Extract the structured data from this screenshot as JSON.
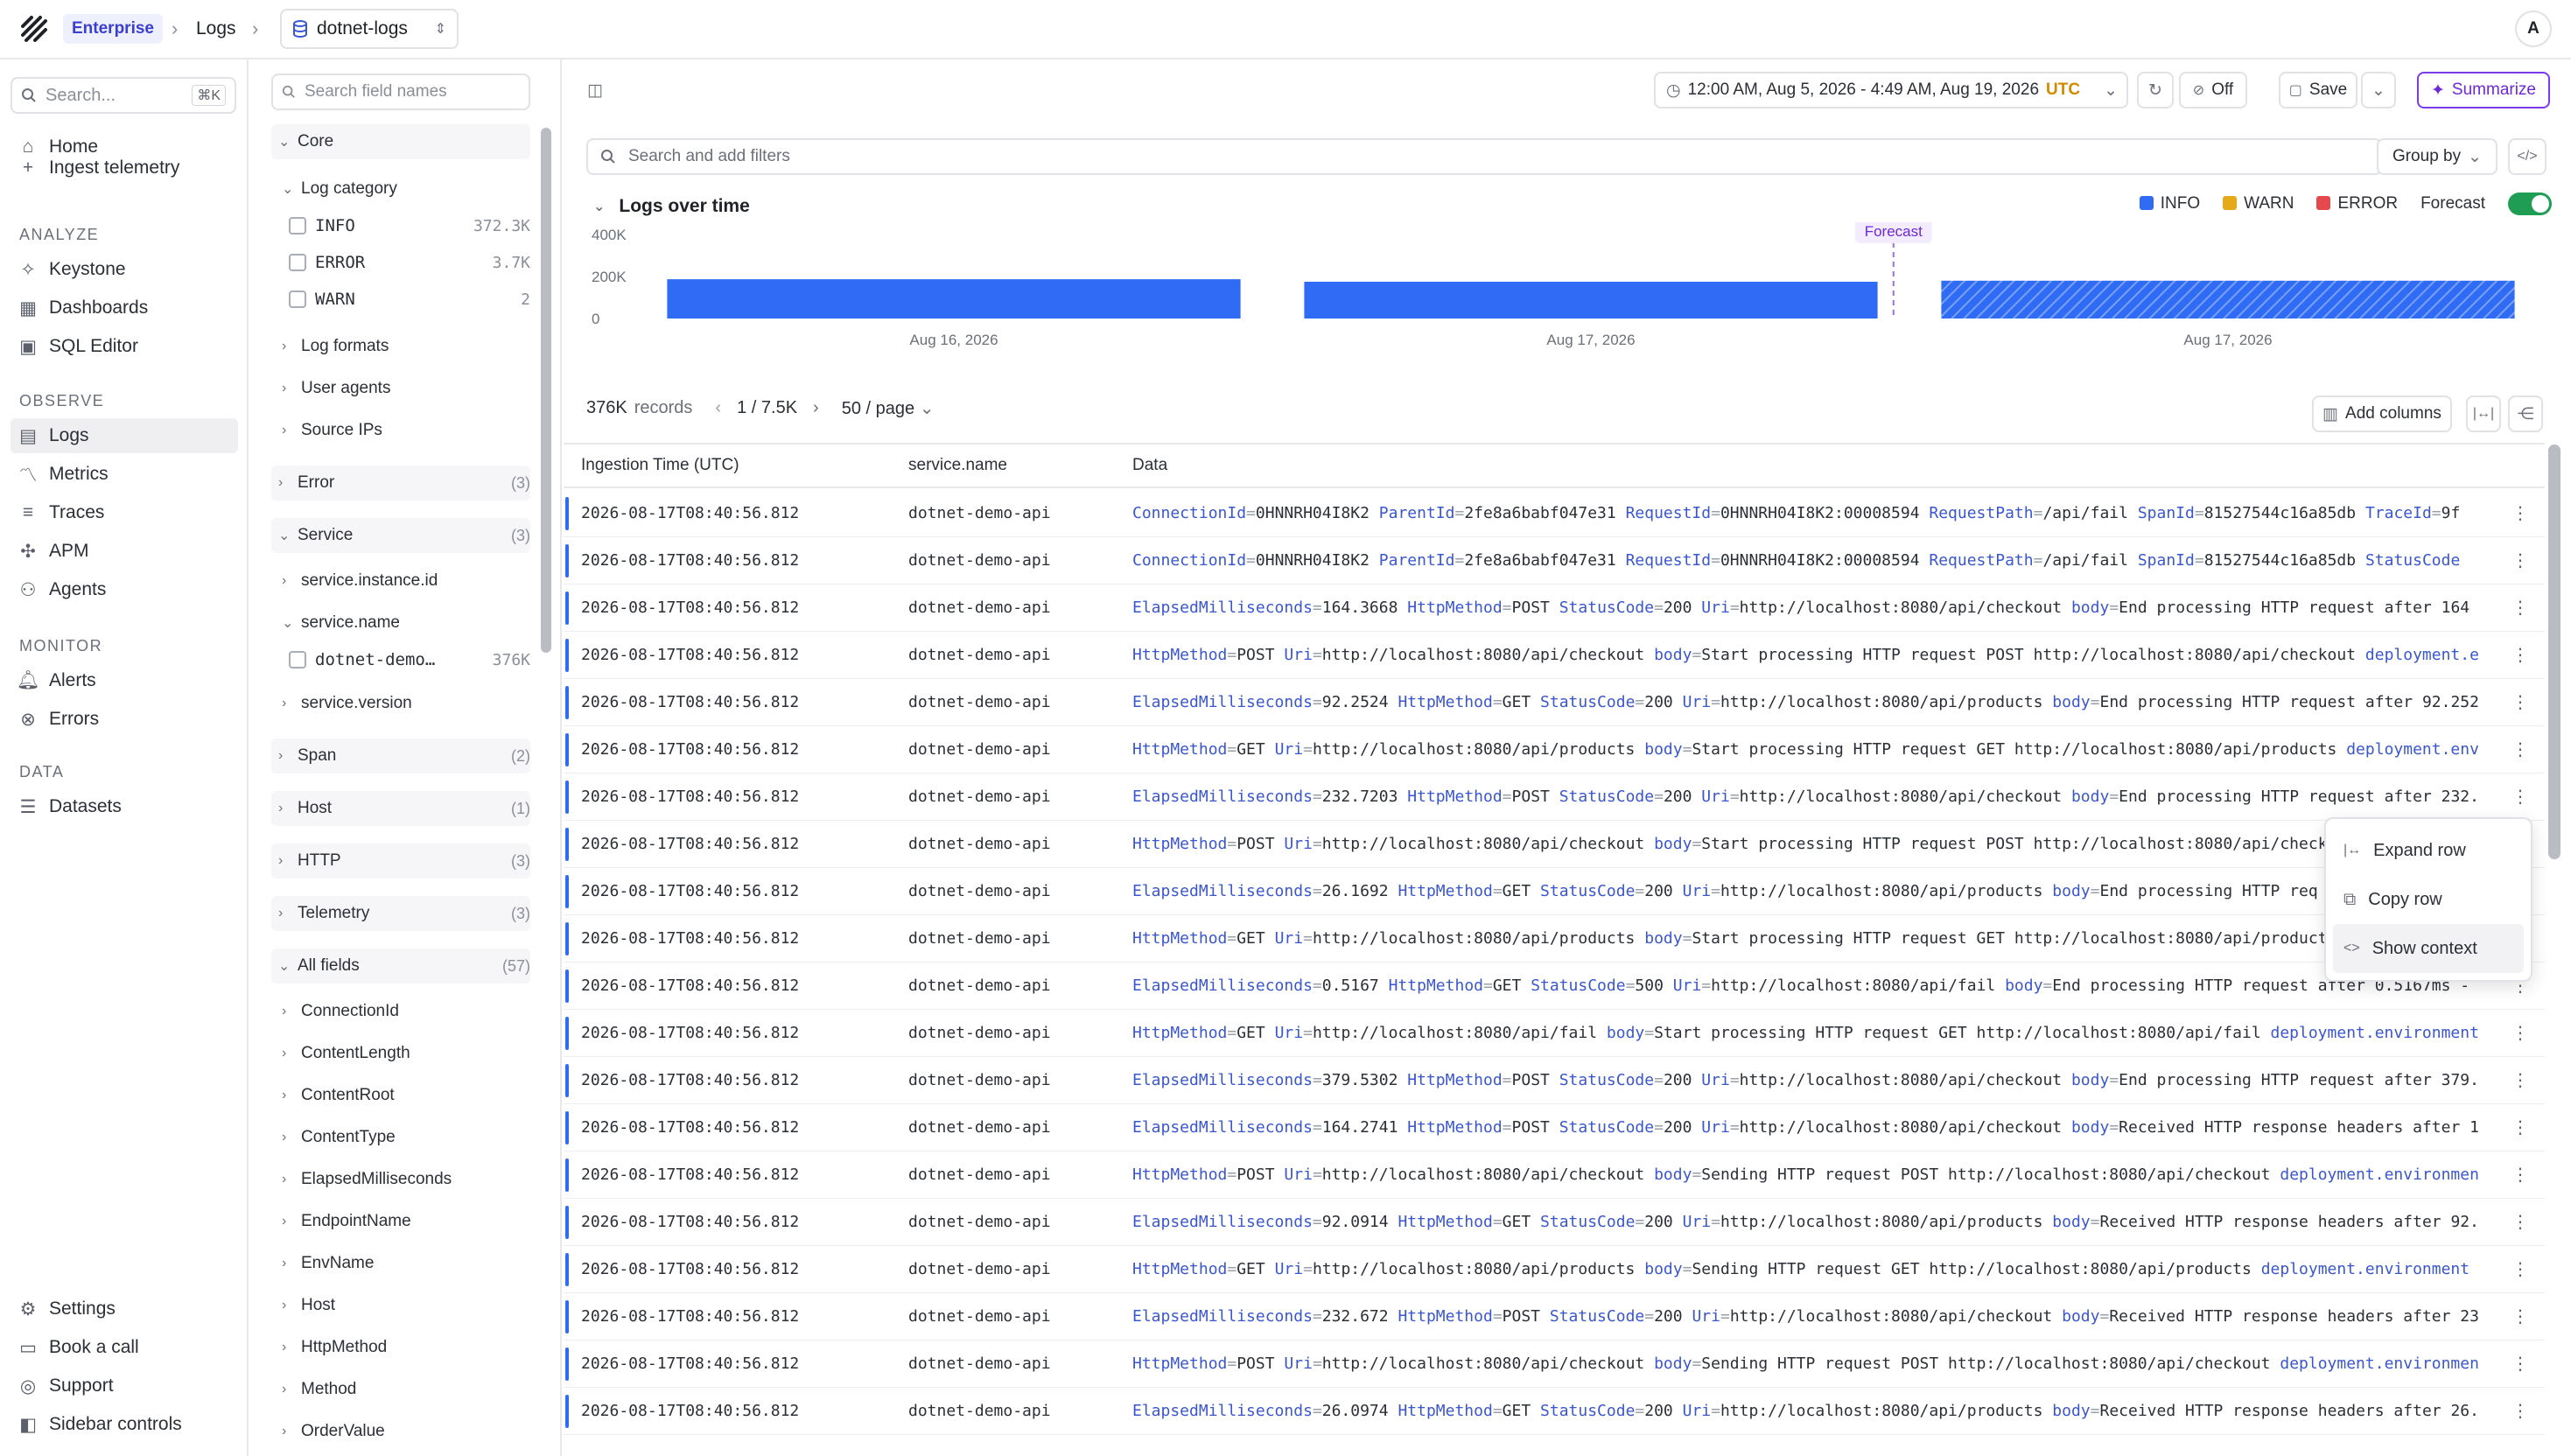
{
  "topbar": {
    "org": "Enterprise",
    "section": "Logs",
    "dataset": "dotnet-logs",
    "avatar_initial": "A"
  },
  "nav": {
    "search_placeholder": "Search...",
    "search_shortcut": "⌘K",
    "top_items": [
      {
        "label": "Home",
        "icon": "home-icon"
      },
      {
        "label": "Ingest telemetry",
        "icon": "plus-icon"
      }
    ],
    "sections": [
      {
        "title": "ANALYZE",
        "items": [
          {
            "label": "Keystone",
            "icon": "sparkle-icon"
          },
          {
            "label": "Dashboards",
            "icon": "dashboard-icon"
          },
          {
            "label": "SQL Editor",
            "icon": "terminal-icon"
          }
        ]
      },
      {
        "title": "OBSERVE",
        "items": [
          {
            "label": "Logs",
            "icon": "logs-icon",
            "active": true
          },
          {
            "label": "Metrics",
            "icon": "metrics-icon"
          },
          {
            "label": "Traces",
            "icon": "traces-icon"
          },
          {
            "label": "APM",
            "icon": "apm-icon"
          },
          {
            "label": "Agents",
            "icon": "agents-icon"
          }
        ]
      },
      {
        "title": "MONITOR",
        "items": [
          {
            "label": "Alerts",
            "icon": "bell-icon"
          },
          {
            "label": "Errors",
            "icon": "error-icon"
          }
        ]
      },
      {
        "title": "DATA",
        "items": [
          {
            "label": "Datasets",
            "icon": "database-icon"
          }
        ]
      }
    ],
    "bottom_items": [
      {
        "label": "Settings",
        "icon": "gear-icon"
      },
      {
        "label": "Book a call",
        "icon": "calendar-icon"
      },
      {
        "label": "Support",
        "icon": "support-icon"
      },
      {
        "label": "Sidebar controls",
        "icon": "sidebar-icon"
      }
    ]
  },
  "fields": {
    "search_placeholder": "Search field names",
    "core": "Core",
    "log_category": "Log category",
    "categories": [
      {
        "name": "INFO",
        "count": "372.3K"
      },
      {
        "name": "ERROR",
        "count": "3.7K"
      },
      {
        "name": "WARN",
        "count": "2"
      }
    ],
    "log_formats": "Log formats",
    "user_agents": "User agents",
    "source_ips": "Source IPs",
    "error": {
      "label": "Error",
      "count": "(3)"
    },
    "service": {
      "label": "Service",
      "count": "(3)"
    },
    "service_instance_id": "service.instance.id",
    "service_name": "service.name",
    "service_name_value": {
      "name": "dotnet-demo…",
      "count": "376K"
    },
    "service_version": "service.version",
    "span": {
      "label": "Span",
      "count": "(2)"
    },
    "host": {
      "label": "Host",
      "count": "(1)"
    },
    "http": {
      "label": "HTTP",
      "count": "(3)"
    },
    "telemetry": {
      "label": "Telemetry",
      "count": "(3)"
    },
    "all_fields": {
      "label": "All fields",
      "count": "(57)"
    },
    "all_field_items": [
      "ConnectionId",
      "ContentLength",
      "ContentRoot",
      "ContentType",
      "ElapsedMilliseconds",
      "EndpointName",
      "EnvName",
      "Host",
      "HttpMethod",
      "Method",
      "OrderValue"
    ]
  },
  "toolbar": {
    "time_range": "12:00 AM, Aug 5, 2026 - 4:49 AM, Aug 19, 2026",
    "timezone": "UTC",
    "refresh_state": "Off",
    "save_label": "Save",
    "summarize_label": "Summarize",
    "filter_placeholder": "Search and add filters",
    "group_by_label": "Group by"
  },
  "chart_data": {
    "type": "bar",
    "title": "Logs over time",
    "categories": [
      "Aug 16, 2026",
      "Aug 17, 2026",
      "Aug 17, 2026"
    ],
    "series": [
      {
        "name": "INFO",
        "values": [
          187000,
          175000,
          180000
        ],
        "color": "#2f6bf5"
      },
      {
        "name": "WARN",
        "values": [
          0,
          0,
          0
        ],
        "color": "#e6a91a"
      },
      {
        "name": "ERROR",
        "values": [
          1800,
          1700,
          1800
        ],
        "color": "#e5484d"
      }
    ],
    "forecast_label": "Forecast",
    "forecast_toggle_label": "Forecast",
    "forecast_start_index": 2,
    "y_ticks": [
      "400K",
      "200K",
      "0"
    ],
    "ylim": [
      0,
      400000
    ]
  },
  "records": {
    "count": "376K",
    "label": "records",
    "page": "1 / 7.5K",
    "per_page": "50 / page",
    "add_columns": "Add columns"
  },
  "table": {
    "headers": [
      "Ingestion Time (UTC)",
      "service.name",
      "Data"
    ],
    "rows": [
      {
        "time": "2026-08-17T08:40:56.812",
        "service": "dotnet-demo-api",
        "data": [
          [
            "ConnectionId",
            "0HNNRH04I8K2"
          ],
          [
            "ParentId",
            "2fe8a6babf047e31"
          ],
          [
            "RequestId",
            "0HNNRH04I8K2:00008594"
          ],
          [
            "RequestPath",
            "/api/fail"
          ],
          [
            "SpanId",
            "81527544c16a85db"
          ],
          [
            "TraceId",
            "9f"
          ]
        ]
      },
      {
        "time": "2026-08-17T08:40:56.812",
        "service": "dotnet-demo-api",
        "data": [
          [
            "ConnectionId",
            "0HNNRH04I8K2"
          ],
          [
            "ParentId",
            "2fe8a6babf047e31"
          ],
          [
            "RequestId",
            "0HNNRH04I8K2:00008594"
          ],
          [
            "RequestPath",
            "/api/fail"
          ],
          [
            "SpanId",
            "81527544c16a85db"
          ],
          [
            "StatusCode",
            ""
          ]
        ]
      },
      {
        "time": "2026-08-17T08:40:56.812",
        "service": "dotnet-demo-api",
        "data": [
          [
            "ElapsedMilliseconds",
            "164.3668"
          ],
          [
            "HttpMethod",
            "POST"
          ],
          [
            "StatusCode",
            "200"
          ],
          [
            "Uri",
            "http://localhost:8080/api/checkout"
          ],
          [
            "body",
            "End processing HTTP request after 164"
          ]
        ]
      },
      {
        "time": "2026-08-17T08:40:56.812",
        "service": "dotnet-demo-api",
        "data": [
          [
            "HttpMethod",
            "POST"
          ],
          [
            "Uri",
            "http://localhost:8080/api/checkout"
          ],
          [
            "body",
            "Start processing HTTP request POST http://localhost:8080/api/checkout"
          ],
          [
            "deployment.e",
            ""
          ]
        ]
      },
      {
        "time": "2026-08-17T08:40:56.812",
        "service": "dotnet-demo-api",
        "data": [
          [
            "ElapsedMilliseconds",
            "92.2524"
          ],
          [
            "HttpMethod",
            "GET"
          ],
          [
            "StatusCode",
            "200"
          ],
          [
            "Uri",
            "http://localhost:8080/api/products"
          ],
          [
            "body",
            "End processing HTTP request after 92.252"
          ]
        ]
      },
      {
        "time": "2026-08-17T08:40:56.812",
        "service": "dotnet-demo-api",
        "data": [
          [
            "HttpMethod",
            "GET"
          ],
          [
            "Uri",
            "http://localhost:8080/api/products"
          ],
          [
            "body",
            "Start processing HTTP request GET http://localhost:8080/api/products"
          ],
          [
            "deployment.env",
            ""
          ]
        ]
      },
      {
        "time": "2026-08-17T08:40:56.812",
        "service": "dotnet-demo-api",
        "data": [
          [
            "ElapsedMilliseconds",
            "232.7203"
          ],
          [
            "HttpMethod",
            "POST"
          ],
          [
            "StatusCode",
            "200"
          ],
          [
            "Uri",
            "http://localhost:8080/api/checkout"
          ],
          [
            "body",
            "End processing HTTP request after 232."
          ]
        ]
      },
      {
        "time": "2026-08-17T08:40:56.812",
        "service": "dotnet-demo-api",
        "data": [
          [
            "HttpMethod",
            "POST"
          ],
          [
            "Uri",
            "http://localhost:8080/api/checkout"
          ],
          [
            "body",
            "Start processing HTTP request POST http://localhost:8080/api/check"
          ]
        ]
      },
      {
        "time": "2026-08-17T08:40:56.812",
        "service": "dotnet-demo-api",
        "data": [
          [
            "ElapsedMilliseconds",
            "26.1692"
          ],
          [
            "HttpMethod",
            "GET"
          ],
          [
            "StatusCode",
            "200"
          ],
          [
            "Uri",
            "http://localhost:8080/api/products"
          ],
          [
            "body",
            "End processing HTTP req"
          ]
        ]
      },
      {
        "time": "2026-08-17T08:40:56.812",
        "service": "dotnet-demo-api",
        "data": [
          [
            "HttpMethod",
            "GET"
          ],
          [
            "Uri",
            "http://localhost:8080/api/products"
          ],
          [
            "body",
            "Start processing HTTP request GET http://localhost:8080/api/product"
          ]
        ]
      },
      {
        "time": "2026-08-17T08:40:56.812",
        "service": "dotnet-demo-api",
        "data": [
          [
            "ElapsedMilliseconds",
            "0.5167"
          ],
          [
            "HttpMethod",
            "GET"
          ],
          [
            "StatusCode",
            "500"
          ],
          [
            "Uri",
            "http://localhost:8080/api/fail"
          ],
          [
            "body",
            "End processing HTTP request after 0.5167ms -"
          ]
        ]
      },
      {
        "time": "2026-08-17T08:40:56.812",
        "service": "dotnet-demo-api",
        "data": [
          [
            "HttpMethod",
            "GET"
          ],
          [
            "Uri",
            "http://localhost:8080/api/fail"
          ],
          [
            "body",
            "Start processing HTTP request GET http://localhost:8080/api/fail"
          ],
          [
            "deployment.environment",
            ""
          ]
        ]
      },
      {
        "time": "2026-08-17T08:40:56.812",
        "service": "dotnet-demo-api",
        "data": [
          [
            "ElapsedMilliseconds",
            "379.5302"
          ],
          [
            "HttpMethod",
            "POST"
          ],
          [
            "StatusCode",
            "200"
          ],
          [
            "Uri",
            "http://localhost:8080/api/checkout"
          ],
          [
            "body",
            "End processing HTTP request after 379."
          ]
        ]
      },
      {
        "time": "2026-08-17T08:40:56.812",
        "service": "dotnet-demo-api",
        "data": [
          [
            "ElapsedMilliseconds",
            "164.2741"
          ],
          [
            "HttpMethod",
            "POST"
          ],
          [
            "StatusCode",
            "200"
          ],
          [
            "Uri",
            "http://localhost:8080/api/checkout"
          ],
          [
            "body",
            "Received HTTP response headers after 1"
          ]
        ]
      },
      {
        "time": "2026-08-17T08:40:56.812",
        "service": "dotnet-demo-api",
        "data": [
          [
            "HttpMethod",
            "POST"
          ],
          [
            "Uri",
            "http://localhost:8080/api/checkout"
          ],
          [
            "body",
            "Sending HTTP request POST http://localhost:8080/api/checkout"
          ],
          [
            "deployment.environmen",
            ""
          ]
        ]
      },
      {
        "time": "2026-08-17T08:40:56.812",
        "service": "dotnet-demo-api",
        "data": [
          [
            "ElapsedMilliseconds",
            "92.0914"
          ],
          [
            "HttpMethod",
            "GET"
          ],
          [
            "StatusCode",
            "200"
          ],
          [
            "Uri",
            "http://localhost:8080/api/products"
          ],
          [
            "body",
            "Received HTTP response headers after 92."
          ]
        ]
      },
      {
        "time": "2026-08-17T08:40:56.812",
        "service": "dotnet-demo-api",
        "data": [
          [
            "HttpMethod",
            "GET"
          ],
          [
            "Uri",
            "http://localhost:8080/api/products"
          ],
          [
            "body",
            "Sending HTTP request GET http://localhost:8080/api/products"
          ],
          [
            "deployment.environment",
            ""
          ]
        ]
      },
      {
        "time": "2026-08-17T08:40:56.812",
        "service": "dotnet-demo-api",
        "data": [
          [
            "ElapsedMilliseconds",
            "232.672"
          ],
          [
            "HttpMethod",
            "POST"
          ],
          [
            "StatusCode",
            "200"
          ],
          [
            "Uri",
            "http://localhost:8080/api/checkout"
          ],
          [
            "body",
            "Received HTTP response headers after 23"
          ]
        ]
      },
      {
        "time": "2026-08-17T08:40:56.812",
        "service": "dotnet-demo-api",
        "data": [
          [
            "HttpMethod",
            "POST"
          ],
          [
            "Uri",
            "http://localhost:8080/api/checkout"
          ],
          [
            "body",
            "Sending HTTP request POST http://localhost:8080/api/checkout"
          ],
          [
            "deployment.environmen",
            ""
          ]
        ]
      },
      {
        "time": "2026-08-17T08:40:56.812",
        "service": "dotnet-demo-api",
        "data": [
          [
            "ElapsedMilliseconds",
            "26.0974"
          ],
          [
            "HttpMethod",
            "GET"
          ],
          [
            "StatusCode",
            "200"
          ],
          [
            "Uri",
            "http://localhost:8080/api/products"
          ],
          [
            "body",
            "Received HTTP response headers after 26."
          ]
        ]
      }
    ]
  },
  "context_menu": {
    "items": [
      {
        "label": "Expand row",
        "icon": "expand-icon"
      },
      {
        "label": "Copy row",
        "icon": "copy-icon"
      },
      {
        "label": "Show context",
        "icon": "code-icon"
      }
    ]
  }
}
